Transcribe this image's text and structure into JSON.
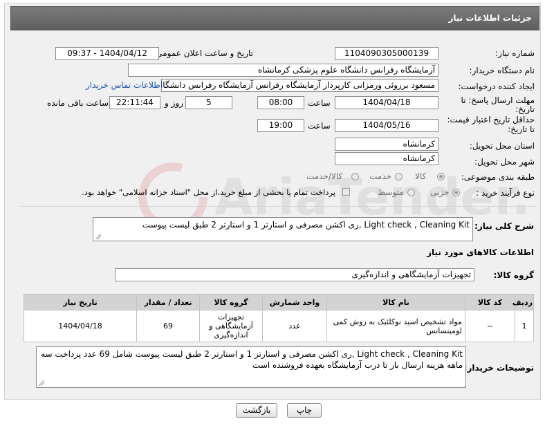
{
  "header": {
    "title": "جزئیات اطلاعات نیاز"
  },
  "fields": {
    "need_number_label": "شماره نیاز:",
    "need_number": "1104090305000139",
    "announce_label": "تاریخ و ساعت اعلان عمومی:",
    "announce_value": "1404/04/12 - 09:37",
    "buyer_org_label": "نام دستگاه خریدار:",
    "buyer_org": "آزمایشگاه رفرانس دانشگاه علوم پزشکی کرمانشاه",
    "requester_label": "ایجاد کننده درخواست:",
    "requester": "مسعود برزوئی ورمزانی کارپرداز آزمایشگاه رفرانس آزمایشگاه رفرانس دانشگاه ع",
    "contact_link": "اطلاعات تماس خریدار",
    "reply_deadline_label_1": "مهلت ارسال پاسخ: تا",
    "reply_deadline_label_2": "تاریخ:",
    "reply_date": "1404/04/18",
    "time_label": "ساعت",
    "reply_time": "08:00",
    "days_count": "5",
    "days_label": "روز و",
    "remaining_time": "22:11:44",
    "remaining_label": "ساعت باقی مانده",
    "price_validity_label_1": "حداقل تاریخ اعتبار قیمت:",
    "price_validity_label_2": "تا تاریخ:",
    "validity_date": "1404/05/16",
    "validity_time": "19:00",
    "province_label": "استان محل تحویل:",
    "province": "کرمانشاه",
    "city_label": "شهر محل تحویل:",
    "city": "کرمانشاه",
    "category_label": "طبقه بندی موضوعی:",
    "category_options": [
      "کالا",
      "خدمت",
      "کالا/خدمت"
    ],
    "process_label": "نوع فرآیند خرید :",
    "process_options": [
      "جزیی",
      "متوسط"
    ],
    "payment_note": "پرداخت تمام یا بخشی از مبلغ خرید،از محل \"اسناد خزانه اسلامی\" خواهد بود."
  },
  "description": {
    "label": "شرح کلی نیاز:",
    "text": "Light check , Cleaning Kit ,ری اکشن مصرفی و استارتر 1 و استارتر 2 طبق لیست پیوست"
  },
  "goods_section": {
    "title": "اطلاعات کالاهای مورد نیاز",
    "group_label": "گروه کالا:",
    "group_value": "تجهیزات آزمایشگاهی و اندازه‌گیری"
  },
  "table": {
    "headers": [
      "ردیف",
      "کد کالا",
      "نام کالا",
      "واحد شمارش",
      "گروه کالا",
      "تعداد / مقدار",
      "تاریخ نیاز"
    ],
    "rows": [
      {
        "row": "1",
        "code": "--",
        "name": "مواد تشخیص اسید نوکلئیک به روش کمی لومینسانس",
        "unit": "عدد",
        "group": "تجهیزات آزمایشگاهی و اندازه‌گیری",
        "qty": "69",
        "date": "1404/04/18"
      }
    ]
  },
  "buyer_notes": {
    "label": "توضیحات خریدار:",
    "text": "Light check , Cleaning Kit ,ری اکشن مصرفی و استارتر 1 و استارتر 2 طبق لیست پیوست شامل 69 عدد پرداخت سه ماهه هزینه ارسال بار تا درب آزمایشگاه بعهده فروشنده است"
  },
  "buttons": {
    "print": "چاپ",
    "back": "بازگشت"
  },
  "watermark": "AriaTender.net",
  "colors": {
    "header_bg": "#6b6b6b",
    "link": "#1a56b0",
    "watermark": "#d23a3a"
  }
}
